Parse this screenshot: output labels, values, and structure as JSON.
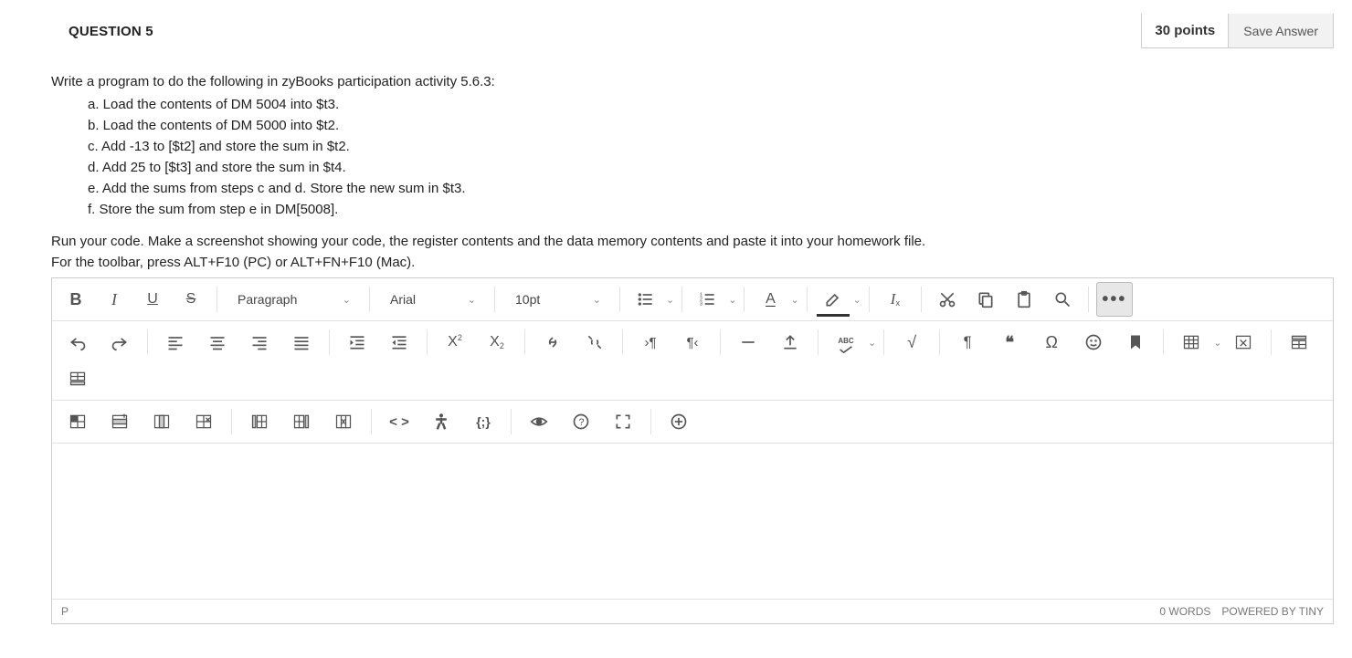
{
  "header": {
    "title": "QUESTION 5",
    "points": "30 points",
    "save_label": "Save Answer"
  },
  "prompt": "Write a program to do the following in zyBooks participation activity 5.6.3:",
  "steps": {
    "a": "a. Load the contents of DM 5004 into $t3.",
    "b": "b. Load the contents of DM 5000 into $t2.",
    "c": "c. Add -13 to [$t2] and store the sum in $t2.",
    "d": "d. Add 25 to [$t3] and store the sum in $t4.",
    "e": "e. Add the sums from steps c and d. Store the new sum in $t3.",
    "f": "f. Store the sum from step e in DM[5008]."
  },
  "note": "Run your code. Make a screenshot showing your code, the register contents and the data memory contents and paste it into your homework file.",
  "help": "For the toolbar, press ALT+F10 (PC) or ALT+FN+F10 (Mac).",
  "toolbar": {
    "block_format": "Paragraph",
    "font_family": "Arial",
    "font_size": "10pt"
  },
  "status": {
    "path": "P",
    "words": "0 WORDS",
    "powered": "POWERED BY TINY"
  }
}
